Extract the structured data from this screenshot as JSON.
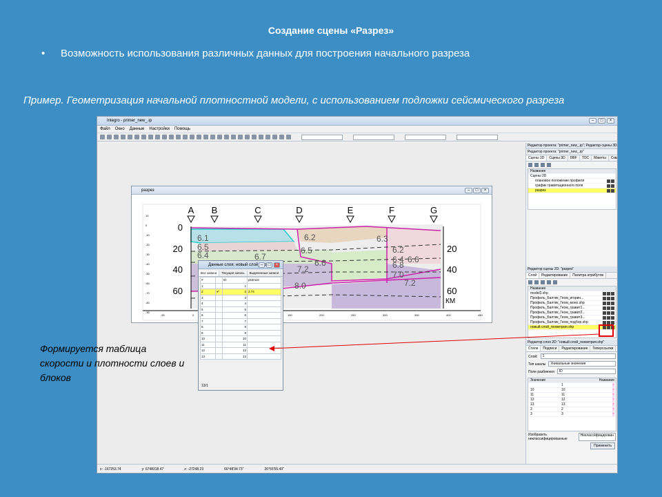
{
  "slide": {
    "title": "Создание сцены «Разрез»",
    "bullet": "Возможность использования различных данных для построения начального разреза",
    "example": "Пример. Геометризация начальной плотностной модели, с использованием подложки сейсмического разреза",
    "callout": "Формируется таблица скорости и плотности слоев и блоков"
  },
  "app": {
    "title": "Integro - primer_new_.ip",
    "menu": [
      "Файл",
      "Окно",
      "Данные",
      "Настройки",
      "Помощь"
    ],
    "status": [
      "x: -167253.74",
      "y: 6748318.47",
      "z: -27248.23",
      "",
      "66°48'34.73\"",
      "26°55'55.43\""
    ]
  },
  "project_editor": {
    "title": "Редактор проекта: \"primer_new_.ip\"; Редактор сцены 3D: ...",
    "subtitle": "Редактор проекта: \"primer_new_.ip\"",
    "tabs": [
      "Сцены 2D",
      "Сцены 3D",
      "DBF",
      "TOC",
      "Макеты",
      "Скважины"
    ],
    "col": "Название",
    "items": [
      "Сцены 2D",
      "плановое положение профиля",
      "график гравитационного поля",
      "разрез"
    ]
  },
  "scene_editor": {
    "title": "Редактор сцены 2D: \"разрез\"",
    "tabs": [
      "Слой",
      "Редактирование",
      "Палитра атрибутов"
    ],
    "col": "Название",
    "items": [
      "model3.shp",
      "Профиль_Балтик_Геом_игорин...",
      "Профиль_Балтик_Геом_моно.shp",
      "Профиль_Балтик_Геом_гравит1...",
      "Профиль_Балтик_Геом_гравит2...",
      "Профиль_Балтик_Геом_гравит3...",
      "Профиль_Балтик_Геом_подбор.shp",
      "новый слой_геометрия.shp"
    ]
  },
  "layer_editor": {
    "title": "Редактор слоя 2D: \"новый слой_геометрия.shp\"",
    "tabs": [
      "Стили",
      "Подписи",
      "Редактирование",
      "Гиперссылки"
    ],
    "layer_label": "Слой:",
    "layer_value": "1",
    "scale_label": "Тип шкалы",
    "scale_value": "Уникальные значения",
    "field_label": "Поле разбиения",
    "field_value": "ID",
    "cols": [
      "Значение",
      "Название"
    ],
    "rows": [
      [
        "",
        "1"
      ],
      [
        "10",
        "10"
      ],
      [
        "11",
        "11"
      ],
      [
        "12",
        "12"
      ],
      [
        "13",
        "13"
      ],
      [
        "2",
        "2"
      ],
      [
        "3",
        "3"
      ]
    ],
    "foot": "Изобразить неклассифицированные",
    "foot2": "Неклассифицирован",
    "apply": "Применить"
  },
  "razrez_window": {
    "title": "разрез"
  },
  "section": {
    "wells": [
      "A",
      "B",
      "C",
      "D",
      "E",
      "F",
      "G"
    ],
    "depths": [
      "0",
      "20",
      "40",
      "60"
    ],
    "depths_right": [
      "20",
      "40",
      "60"
    ],
    "km": "КМ",
    "densities": [
      "6.1",
      "6.5",
      "6.4",
      "6.2",
      "6.3",
      "6.2",
      "6.4",
      "6.7",
      "6.5",
      "6.6",
      "6.8",
      "6.6",
      "7.2",
      "7.0",
      "7.2",
      "8.0"
    ],
    "yticks": [
      "10",
      "0",
      "-10",
      "-20",
      "-30",
      "-40",
      "-50",
      "-60",
      "-70",
      "-80",
      "-90"
    ],
    "xticks": [
      "-50",
      "0",
      "50",
      "100",
      "150",
      "200",
      "250",
      "300",
      "350",
      "400",
      "450"
    ]
  },
  "layers_table": {
    "title": "Данные слоя: новый слой_гео...",
    "tabs": [
      "Все записи",
      "Текущая запись",
      "Выделенные записи"
    ],
    "cols": [
      "#",
      "",
      "ID",
      "plotnost"
    ],
    "rows": [
      [
        "1",
        "",
        "1",
        ""
      ],
      [
        "2",
        "✔",
        "2",
        "2.74"
      ],
      [
        "3",
        "",
        "3",
        ""
      ],
      [
        "4",
        "",
        "4",
        ""
      ],
      [
        "5",
        "",
        "5",
        ""
      ],
      [
        "6",
        "",
        "6",
        ""
      ],
      [
        "7",
        "",
        "7",
        ""
      ],
      [
        "8",
        "",
        "8",
        ""
      ],
      [
        "9",
        "",
        "9",
        ""
      ],
      [
        "10",
        "",
        "10",
        ""
      ],
      [
        "11",
        "",
        "11",
        ""
      ],
      [
        "12",
        "",
        "12",
        ""
      ],
      [
        "13",
        "",
        "13",
        ""
      ]
    ],
    "footer": "13/1"
  }
}
